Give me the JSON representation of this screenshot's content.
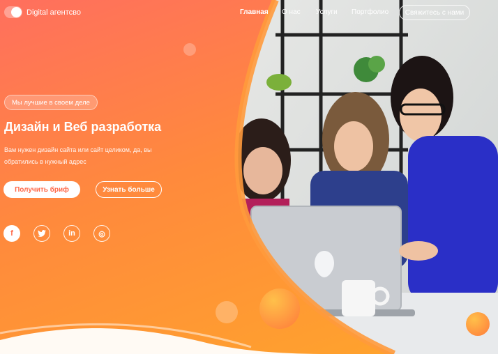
{
  "brand": {
    "name": "Digital агентсво"
  },
  "nav": {
    "items": [
      "Главная",
      "О нас",
      "Услуги",
      "Портфолио"
    ],
    "cta": "Свяжитесь с нами"
  },
  "hero": {
    "badge": "Мы лучшие в своем деле",
    "title": "Дизайн и Веб разработка",
    "description": "Вам нужен дизайн сайта или сайт целиком, да, вы обратились в нужный адрес",
    "primary_button": "Получить бриф",
    "secondary_button": "Узнать больше"
  },
  "social": {
    "icons": [
      "facebook-icon",
      "twitter-icon",
      "linkedin-icon",
      "instagram-icon"
    ],
    "glyphs": [
      "f",
      "t",
      "in",
      "◎"
    ]
  },
  "colors": {
    "gradient_start": "#ff6f5e",
    "gradient_mid": "#ff8a3c",
    "gradient_end": "#ffa62b",
    "accent": "#ff6a4a",
    "text": "#ffffff"
  }
}
